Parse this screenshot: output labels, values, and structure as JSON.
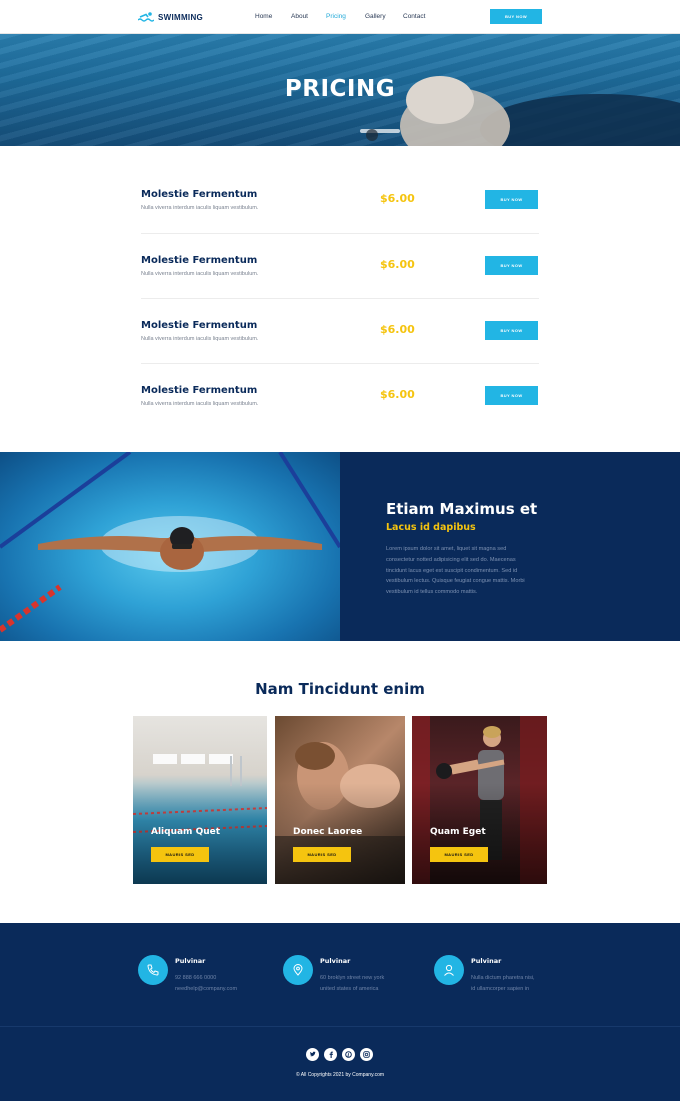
{
  "nav": {
    "logo": "SWIMMING",
    "items": [
      "Home",
      "About",
      "Pricing",
      "Gallery",
      "Contact"
    ],
    "active": "Pricing",
    "button": "BUY NOW"
  },
  "hero": {
    "title": "PRICING"
  },
  "pricing": {
    "items": [
      {
        "name": "Molestie Fermentum",
        "desc": "Nulla viverra interdum iaculis liquam vestibulum.",
        "price": "$6.00",
        "button": "BUY NOW"
      },
      {
        "name": "Molestie Fermentum",
        "desc": "Nulla viverra interdum iaculis liquam vestibulum.",
        "price": "$6.00",
        "button": "BUY NOW"
      },
      {
        "name": "Molestie Fermentum",
        "desc": "Nulla viverra interdum iaculis liquam vestibulum.",
        "price": "$6.00",
        "button": "BUY NOW"
      },
      {
        "name": "Molestie Fermentum",
        "desc": "Nulla viverra interdum iaculis liquam vestibulum.",
        "price": "$6.00",
        "button": "BUY NOW"
      }
    ]
  },
  "feature": {
    "title": "Etiam Maximus et",
    "subtitle": "Lacus id dapibus",
    "text": [
      "Lorem ipsum dolor sit amet, liquet sit magna sed",
      "consectetur notted adipisicing elit sed do. Maecenas",
      "tincidunt lacus eget est suscipit condimentum. Sed id",
      "vestibulum lectus. Quisque feugiat congue mattis. Morbi",
      "vestibulum id tellus commodo mattis."
    ]
  },
  "services": {
    "title": "Nam Tincidunt enim",
    "cards": [
      {
        "title": "Aliquam Quet",
        "button": "MAURIS SED"
      },
      {
        "title": "Donec Laoree",
        "button": "MAURIS SED"
      },
      {
        "title": "Quam Eget",
        "button": "MAURIS SED"
      }
    ]
  },
  "footer": {
    "contacts": [
      {
        "icon": "phone-icon",
        "title": "Pulvinar",
        "lines": [
          "92 888 666 0000",
          "needhelp@company.com"
        ]
      },
      {
        "icon": "map-pin-icon",
        "title": "Pulvinar",
        "lines": [
          "60 broklyn street new york",
          "united states of america"
        ]
      },
      {
        "icon": "user-icon",
        "title": "Pulvinar",
        "lines": [
          "Nulla dictum pharetra nisi,",
          "id ullamcorper sapien in"
        ]
      }
    ],
    "social": [
      "twitter-icon",
      "facebook-icon",
      "pinterest-icon",
      "instagram-icon"
    ],
    "copyright": "© All Copyrights 2021 by Company.com"
  },
  "colors": {
    "navy": "#0a2a5a",
    "accent": "#22b5e4",
    "yellow": "#f5c40f"
  }
}
